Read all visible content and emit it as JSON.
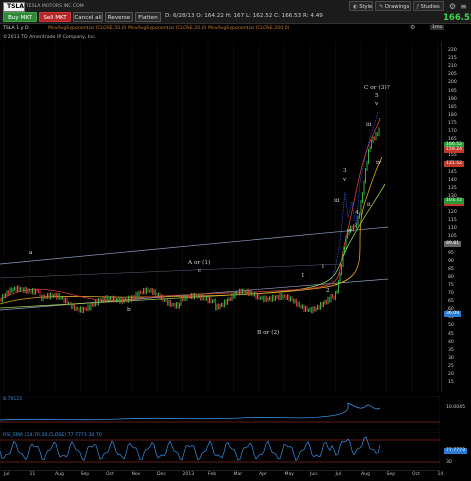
{
  "toolbar": {
    "symbol": "TSLA",
    "company": "TESLA MOTORS INC COM",
    "buy_label": "Buy MKT",
    "sell_label": "Sell MKT",
    "cancel_label": "Cancel all",
    "reverse_label": "Reverse",
    "flatten_label": "Flatten",
    "quote": "D: 6/28/13   O: 164.22   H: 167   L: 162.52   C: 166.53   R: 4.49",
    "style_label": "Style",
    "drawings_label": "Drawings",
    "studies_label": "Studies",
    "last_price": "166.52"
  },
  "chart_header": {
    "line1": "©2013 TD Ameritrade IP Company, Inc.",
    "symbol_line": "TSLA 1 y D",
    "studies_text": "MovAvgExponential (CLOSE,50,0)  MovAvgExponential (CLOSE,20,0)  MovAvgExponential (CLOSE,200,0)",
    "lower1_label": "8.76121",
    "lower2_label": "RSI_EMA (14,70,30,CLOSE)   77.7773   30   70",
    "ident": "1mo"
  },
  "price_axis": {
    "labels": [
      "220",
      "215",
      "210",
      "205",
      "200",
      "195",
      "190",
      "185",
      "180",
      "175",
      "170",
      "165",
      "160",
      "155",
      "150",
      "145",
      "140",
      "135",
      "130",
      "125",
      "120",
      "115",
      "110",
      "105",
      "100",
      "95",
      "90",
      "85",
      "80",
      "75",
      "70",
      "65",
      "60",
      "55",
      "50",
      "45",
      "40",
      "35",
      "30",
      "25",
      "20",
      "15"
    ],
    "tags": [
      {
        "text": "166.52",
        "color": "#2a9a35"
      },
      {
        "text": "159.24",
        "color": "#c0392b"
      },
      {
        "text": "131.52",
        "color": "#c0392b"
      },
      {
        "text": "131.03",
        "color": "#c0392b"
      },
      {
        "text": "103.72",
        "color": "#2a9a35"
      },
      {
        "text": "89.81",
        "color": "#666666"
      },
      {
        "text": "36.09",
        "color": "#2a7bd6"
      }
    ],
    "lower1_value": "10.0045",
    "lower2_value": "77.7773",
    "lower2_ref": "30"
  },
  "x_axis": {
    "labels": [
      "Jul",
      "11",
      "Aug",
      "Sep",
      "Oct",
      "Nov",
      "Dec",
      "2013",
      "Feb",
      "Mar",
      "Apr",
      "May",
      "Jun",
      "Jul",
      "Aug",
      "Sep",
      "Oct",
      "14"
    ]
  },
  "annotations": {
    "a": "a",
    "b": "b",
    "c": "c",
    "a_or_1": "A or (1)",
    "b_or_2": "B or (2)",
    "c_or_3": "C or (3)?",
    "w1": "1",
    "w2": "2",
    "w3": "3",
    "w4": "4",
    "w5": "5",
    "r_i": "i",
    "r_iii": "iii",
    "r_iv": "iv",
    "r_v": "v",
    "r_ii": "ii",
    "r_iii2": "iii",
    "r_iv2": "iv",
    "r_v2": "v"
  },
  "colors": {
    "up_candle": "#3cc24a",
    "down_candle": "#d83a3a",
    "ema20": "#d83a3a",
    "ema50": "#e0a81a",
    "ema200": "#9ccc50",
    "channel": "#8f9fc2",
    "wave_blue": "#3a63ff"
  }
}
